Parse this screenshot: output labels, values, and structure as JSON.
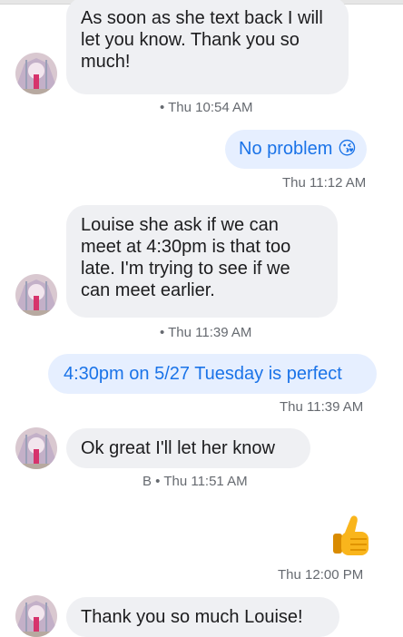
{
  "messages": [
    {
      "direction": "incoming",
      "text": "As soon as she text back I will let you know. Thank you so much!",
      "meta": "• Thu 10:54 AM"
    },
    {
      "direction": "outgoing",
      "text": "No problem",
      "emoji": "😘",
      "meta": "Thu 11:12 AM"
    },
    {
      "direction": "incoming",
      "text": "Louise she ask if we can meet at 4:30pm is that too late. I'm trying to see if we can meet earlier.",
      "meta": "• Thu 11:39 AM"
    },
    {
      "direction": "outgoing",
      "text": "4:30pm on 5/27 Tuesday is perfect",
      "meta": "Thu 11:39 AM"
    },
    {
      "direction": "incoming",
      "text": "Ok great I'll let her know",
      "meta": "B • Thu 11:51 AM"
    },
    {
      "direction": "outgoing",
      "sticker": "thumbs-up",
      "meta": "Thu 12:00 PM"
    },
    {
      "direction": "incoming",
      "text": "Thank you so much Louise!",
      "meta": ""
    }
  ],
  "avatar": {
    "icon": "contact-avatar-icon"
  },
  "colors": {
    "incoming_bubble": "#eff0f3",
    "outgoing_bubble": "#e6efff",
    "outgoing_text": "#1a73e8",
    "meta_text": "#666a70"
  }
}
